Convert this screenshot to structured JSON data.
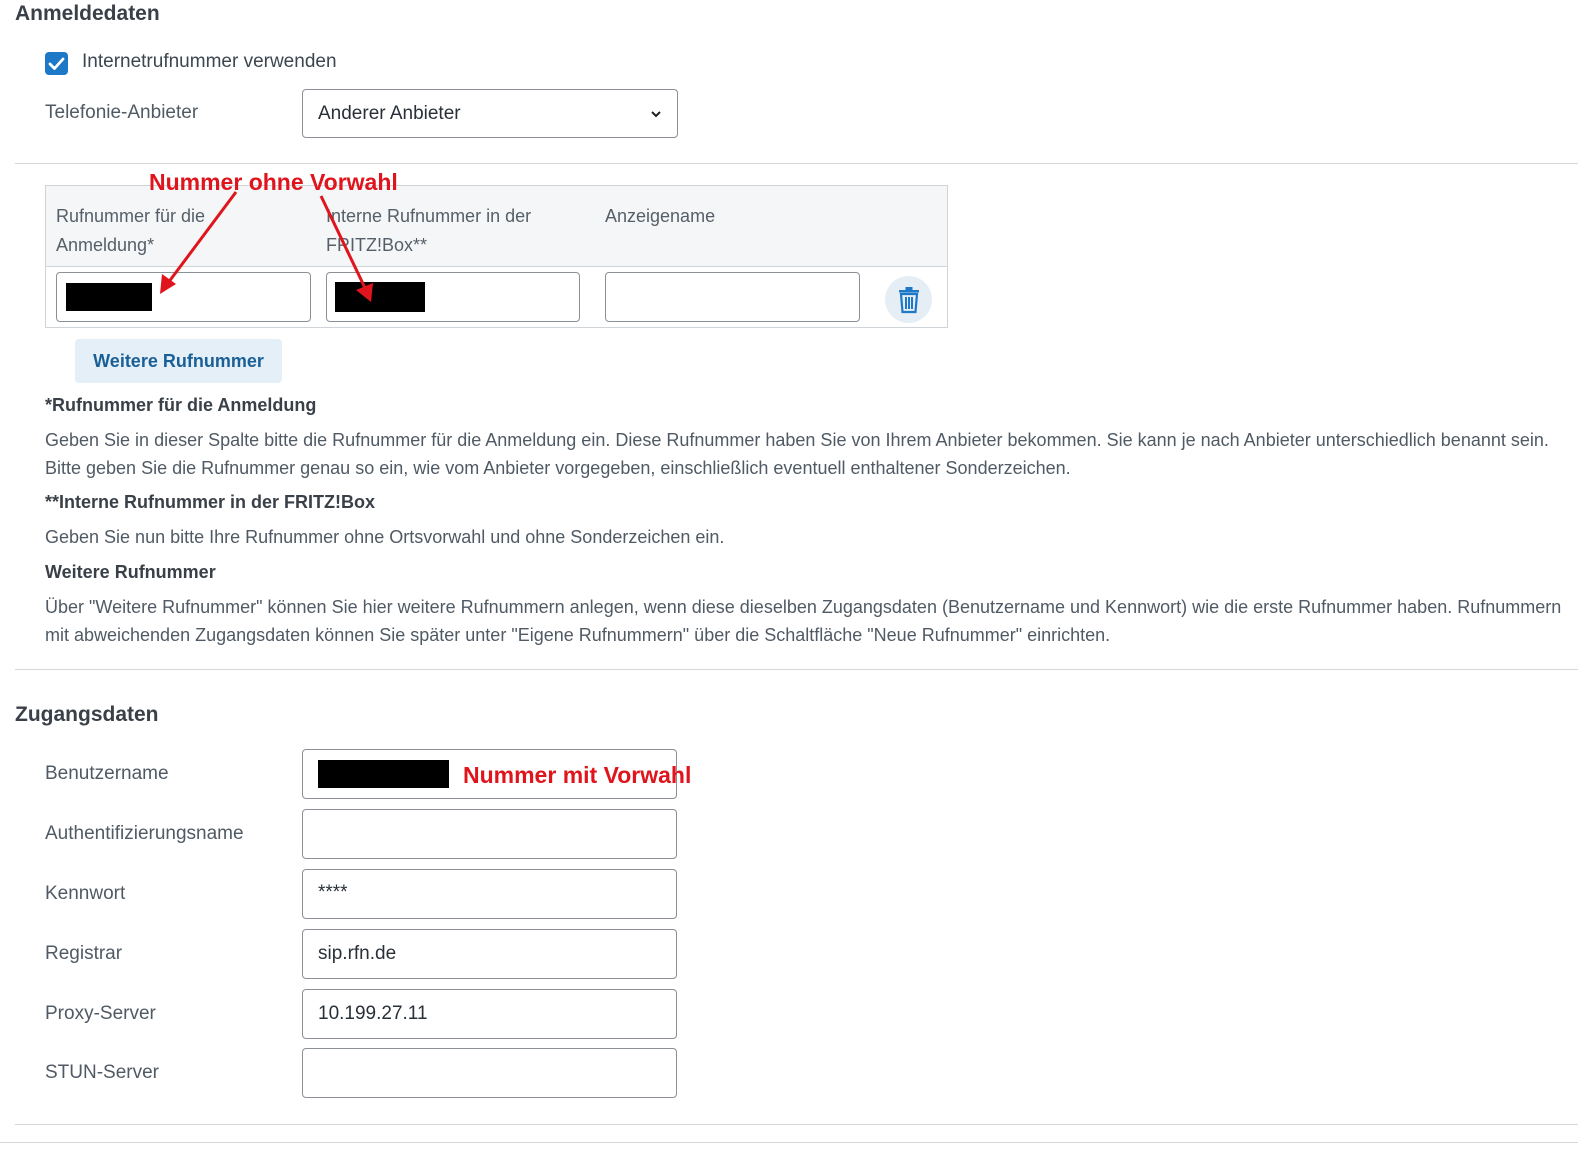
{
  "anmeldedaten": {
    "heading": "Anmeldedaten",
    "checkbox_label": "Internetrufnummer verwenden",
    "provider_label": "Telefonie-Anbieter",
    "provider_value": "Anderer Anbieter"
  },
  "table": {
    "col1": "Rufnummer für die Anmeldung*",
    "col2": "Interne Rufnummer in der FRITZ!Box**",
    "col3": "Anzeigename",
    "display_name_value": ""
  },
  "add_number_button": "Weitere Rufnummer",
  "annotations": {
    "without_area_code": "Nummer ohne Vorwahl",
    "with_area_code": "Nummer mit Vorwahl"
  },
  "notes": {
    "h1": "*Rufnummer für die Anmeldung",
    "p1": "Geben Sie in dieser Spalte bitte die Rufnummer für die Anmeldung ein. Diese Rufnummer haben Sie von Ihrem Anbieter bekommen. Sie kann je nach Anbieter unterschiedlich benannt sein. Bitte geben Sie die Rufnummer genau so ein, wie vom Anbieter vorgegeben, einschließlich eventuell enthaltener Sonderzeichen.",
    "h2": "**Interne Rufnummer in der FRITZ!Box",
    "p2": "Geben Sie nun bitte Ihre Rufnummer ohne Ortsvorwahl und ohne Sonderzeichen ein.",
    "h3": "Weitere Rufnummer",
    "p3": "Über \"Weitere Rufnummer\" können Sie hier weitere Rufnummern anlegen, wenn diese dieselben Zugangsdaten (Benutzername und Kennwort) wie die erste Rufnummer haben. Rufnummern mit abweichenden Zugangsdaten können Sie später unter \"Eigene Rufnummern\" über die Schaltfläche \"Neue Rufnummer\" einrichten."
  },
  "zugangsdaten": {
    "heading": "Zugangsdaten",
    "username_label": "Benutzername",
    "auth_label": "Authentifizierungsname",
    "auth_value": "",
    "password_label": "Kennwort",
    "password_value": "****",
    "registrar_label": "Registrar",
    "registrar_value": "sip.rfn.de",
    "proxy_label": "Proxy-Server",
    "proxy_value": "10.199.27.11",
    "stun_label": "STUN-Server",
    "stun_value": ""
  },
  "colors": {
    "accent": "#1e78c8",
    "annotation_red": "#e0141c",
    "button_bg": "#e4eff8",
    "button_text": "#1a5f96"
  }
}
